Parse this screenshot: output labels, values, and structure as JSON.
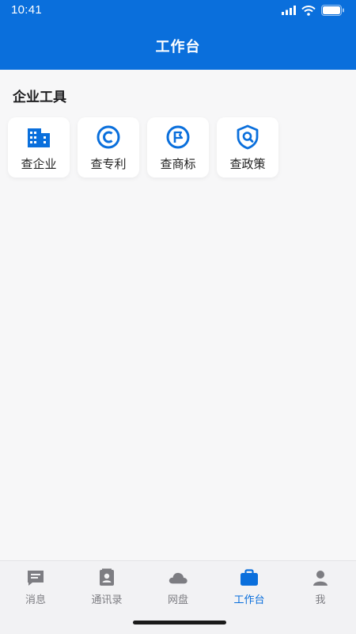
{
  "status_bar": {
    "time": "10:41"
  },
  "header": {
    "title": "工作台"
  },
  "section": {
    "title": "企业工具"
  },
  "tools": [
    {
      "label": "查企业",
      "icon": "building-icon"
    },
    {
      "label": "查专利",
      "icon": "copyright-icon"
    },
    {
      "label": "查商标",
      "icon": "flag-icon"
    },
    {
      "label": "查政策",
      "icon": "shield-search-icon"
    }
  ],
  "tabbar": {
    "items": [
      {
        "label": "消息",
        "icon": "chat-icon",
        "active": false
      },
      {
        "label": "通讯录",
        "icon": "contacts-icon",
        "active": false
      },
      {
        "label": "网盘",
        "icon": "cloud-icon",
        "active": false
      },
      {
        "label": "工作台",
        "icon": "briefcase-icon",
        "active": true
      },
      {
        "label": "我",
        "icon": "person-icon",
        "active": false
      }
    ]
  },
  "colors": {
    "primary": "#0a6fdc",
    "inactive": "#7d7d82"
  }
}
